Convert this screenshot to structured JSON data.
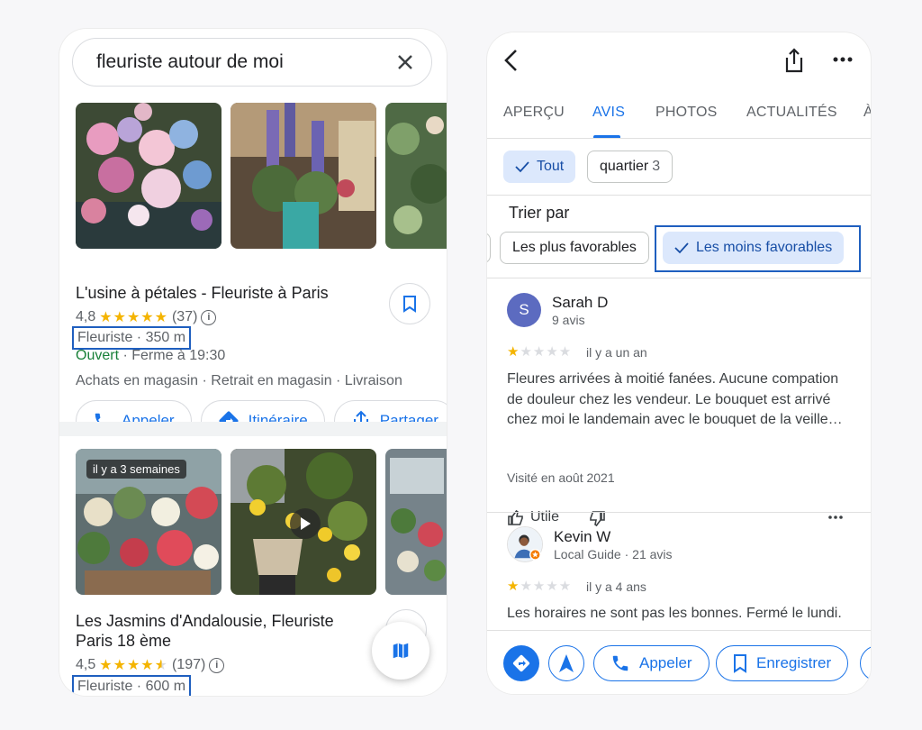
{
  "left": {
    "search": {
      "query": "fleuriste autour de moi"
    },
    "results": [
      {
        "title": "L'usine à pétales - Fleuriste à Paris",
        "rating": "4,8",
        "stars": "★★★★★",
        "reviews": "(37)",
        "category": "Fleuriste · 350 m",
        "open_label": "Ouvert",
        "close_label": "· Ferme à 19:30",
        "services": "Achats en magasin · Retrait en magasin · Livraison",
        "actions": {
          "call": "Appeler",
          "directions": "Itinéraire",
          "share": "Partager"
        }
      },
      {
        "title": "Les Jasmins d'Andalousie, Fleuriste Paris 18 ème",
        "photo_badge": "il y a 3 semaines",
        "rating": "4,5",
        "stars_full": "★★★★",
        "stars_half": "★",
        "reviews": "(197)",
        "category": "Fleuriste · 600 m"
      }
    ]
  },
  "right": {
    "tabs": [
      "APERÇU",
      "AVIS",
      "PHOTOS",
      "ACTUALITÉS",
      "À"
    ],
    "filters": {
      "all_label": "Tout",
      "topic_label": "quartier",
      "topic_count": "3"
    },
    "sort": {
      "title": "Trier par",
      "option_most": "Les plus favorables",
      "option_least": "Les moins favorables"
    },
    "reviews": [
      {
        "initial": "S",
        "name": "Sarah D",
        "sub": "9 avis",
        "stars_on": "★",
        "stars_off": "★★★★",
        "time": "il y a un an",
        "text": "Fleures arrivées à moitié fanées. Aucune compation de douleur chez les vendeur. Le bouquet est arrivé chez moi le landemain avec le bouquet de la veille…",
        "visit": "Visité en août 2021",
        "useful_label": "Utile"
      },
      {
        "name": "Kevin W",
        "sub": "Local Guide · 21 avis",
        "stars_on": "★",
        "stars_off": "★★★★",
        "time": "il y a 4 ans",
        "text": "Les horaires ne sont pas les bonnes. Fermé le lundi."
      }
    ],
    "bottom": {
      "call": "Appeler",
      "save": "Enregistrer"
    }
  },
  "colors": {
    "accent": "#1a73e8",
    "highlight_box": "#1f5fbf",
    "star": "#f4b400",
    "open": "#188038"
  }
}
